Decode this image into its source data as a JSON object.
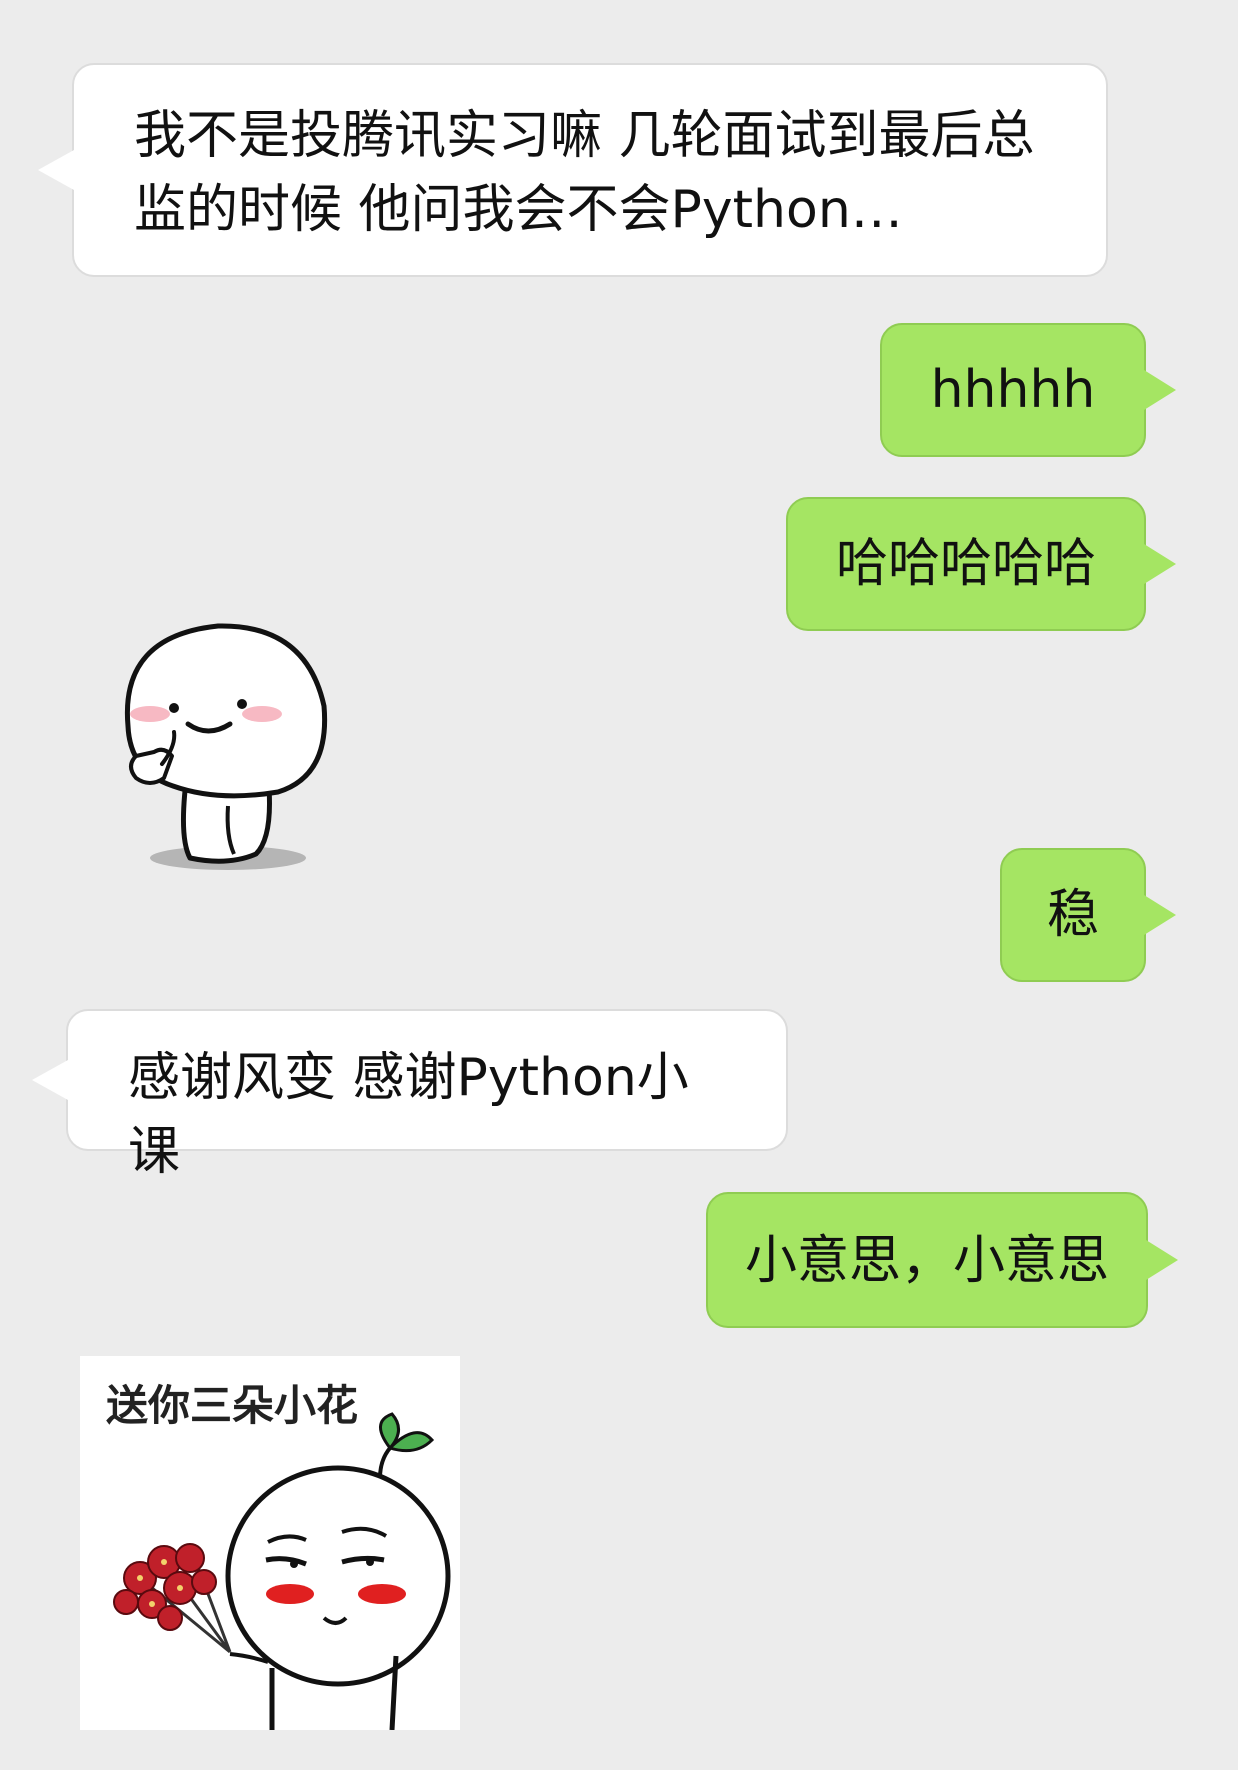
{
  "messages": [
    {
      "side": "left",
      "text": "我不是投腾讯实习嘛 几轮面试到最后总监的时候 他问我会不会Python…"
    },
    {
      "side": "right",
      "text": "hhhhh"
    },
    {
      "side": "right",
      "text": "哈哈哈哈哈"
    },
    {
      "side": "left",
      "sticker": "thinking-bun-sticker"
    },
    {
      "side": "right",
      "text": "稳"
    },
    {
      "side": "left",
      "text": "感谢风变 感谢Python小课"
    },
    {
      "side": "right",
      "text": "小意思，小意思"
    },
    {
      "side": "left",
      "sticker": "flower-bun-sticker",
      "caption": "送你三朵小花"
    }
  ],
  "colors": {
    "background": "#ececec",
    "incoming": "#ffffff",
    "outgoing": "#a5e563"
  }
}
